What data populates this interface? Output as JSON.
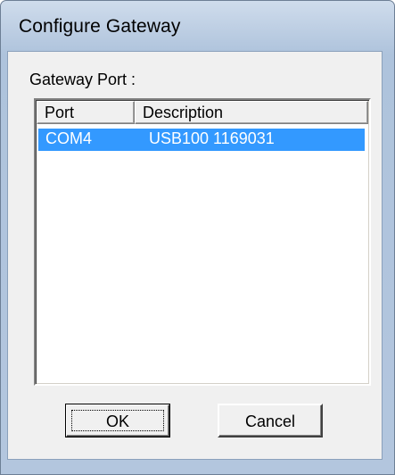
{
  "window": {
    "title": "Configure Gateway"
  },
  "gateway_port": {
    "label": "Gateway Port :",
    "columns": [
      "Port",
      "Description"
    ],
    "rows": [
      {
        "port": "COM4",
        "description": "USB100 1169031",
        "selected": true
      }
    ]
  },
  "buttons": {
    "ok_label": "OK",
    "cancel_label": "Cancel"
  },
  "colors": {
    "selection": "#3399ff",
    "title_bar": "#b9cbe1"
  }
}
